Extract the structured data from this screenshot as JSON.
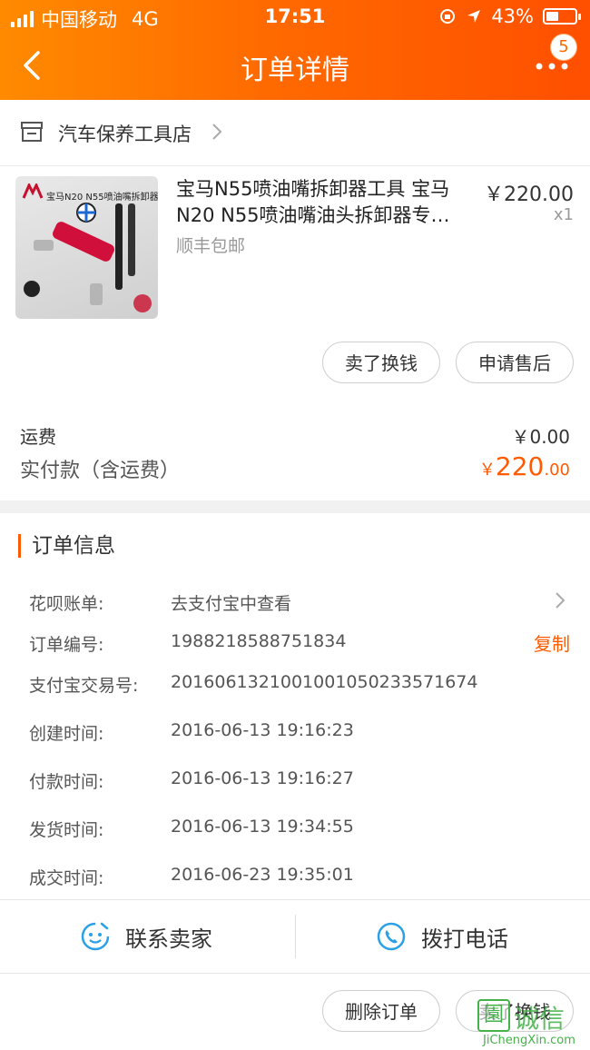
{
  "status_bar": {
    "carrier": "中国移动",
    "network": "4G",
    "time": "17:51",
    "battery_percent_text": "43%",
    "battery_level": 0.43
  },
  "nav": {
    "title": "订单详情",
    "badge_count": "5",
    "back_icon": "chevron-left-icon",
    "more_icon": "more-dots-icon"
  },
  "shop": {
    "name": "汽车保养工具店",
    "icon": "store-icon"
  },
  "product": {
    "title_line1": "宝马N55喷油嘴拆卸器工具 宝马",
    "title_line2": "N20 N55喷油嘴油头拆卸器专…",
    "shipping_tag": "顺丰包邮",
    "price": "￥220.00",
    "quantity": "x1",
    "image_caption": "宝马N20 N55喷油嘴拆卸器"
  },
  "actions": {
    "sell_label": "卖了换钱",
    "after_sale_label": "申请售后",
    "delete_label": "删除订单",
    "sell_bottom_label": "卖了换钱"
  },
  "totals": {
    "freight_label": "运费",
    "freight_value": "￥0.00",
    "paid_label": "实付款（含运费）",
    "paid_currency": "￥",
    "paid_int": "220",
    "paid_dec": ".00"
  },
  "order_info": {
    "title": "订单信息",
    "rows": [
      {
        "label": "花呗账单:",
        "value": "去支付宝中查看"
      },
      {
        "label": "订单编号:",
        "value": "1988218588751834"
      },
      {
        "label": "支付宝交易号:",
        "value": "2016061321001001050233571674"
      },
      {
        "label": "创建时间:",
        "value": "2016-06-13 19:16:23"
      },
      {
        "label": "付款时间:",
        "value": "2016-06-13 19:16:27"
      },
      {
        "label": "发货时间:",
        "value": "2016-06-13 19:34:55"
      },
      {
        "label": "成交时间:",
        "value": "2016-06-23 19:35:01"
      }
    ],
    "copy_label": "复制"
  },
  "contact": {
    "seller_label": "联系卖家",
    "phone_label": "拨打电话"
  },
  "watermark": {
    "text": "诚信",
    "url": "JiChengXin.com"
  },
  "colors": {
    "accent": "#ff5a00",
    "header_start": "#ff8a00",
    "header_end": "#ff4f00",
    "watermark": "#44b248"
  }
}
